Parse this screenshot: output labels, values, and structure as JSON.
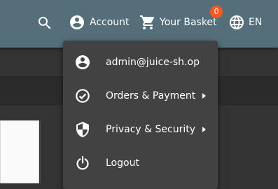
{
  "toolbar": {
    "account_label": "Account",
    "basket_label": "Your Basket",
    "basket_count": "0",
    "language_label": "EN"
  },
  "account_menu": {
    "items": [
      {
        "label": "admin@juice-sh.op",
        "icon": "account-circle-icon",
        "has_submenu": false
      },
      {
        "label": "Orders & Payment",
        "icon": "check-circle-icon",
        "has_submenu": true
      },
      {
        "label": "Privacy & Security",
        "icon": "shield-icon",
        "has_submenu": true
      },
      {
        "label": "Logout",
        "icon": "power-icon",
        "has_submenu": false
      }
    ]
  },
  "colors": {
    "toolbar": "#546e7a",
    "menu": "#424242",
    "background": "#333333",
    "badge": "#ff5722"
  }
}
